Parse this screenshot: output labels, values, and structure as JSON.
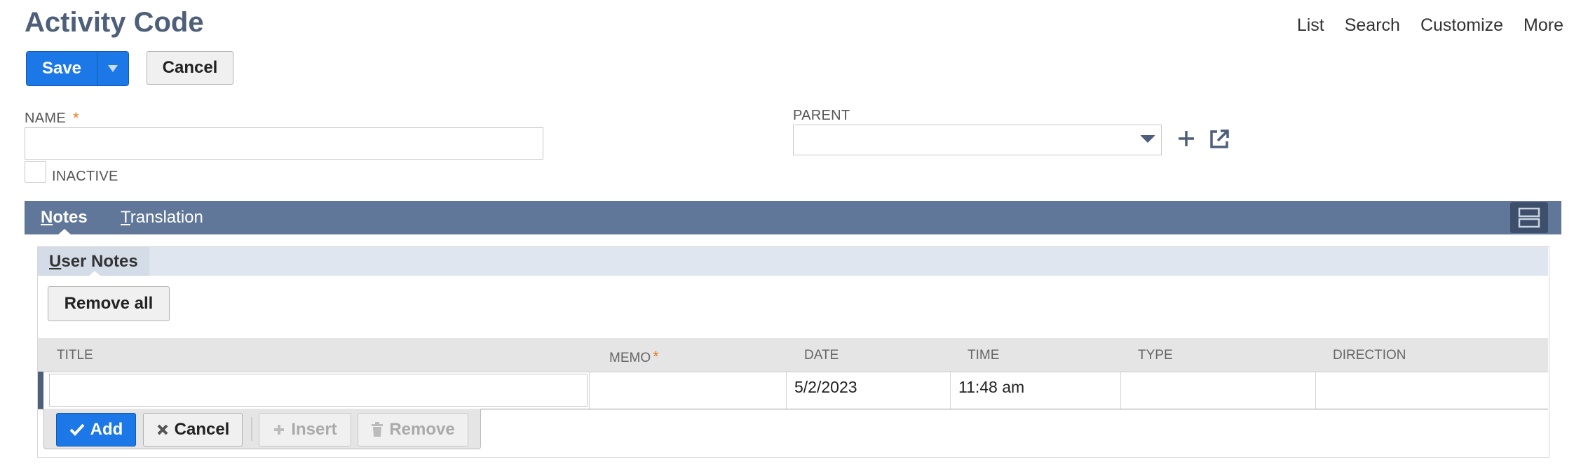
{
  "header": {
    "title": "Activity Code",
    "nav": [
      "List",
      "Search",
      "Customize",
      "More"
    ]
  },
  "toolbar": {
    "save_label": "Save",
    "cancel_label": "Cancel"
  },
  "form": {
    "name_label": "NAME",
    "required_mark": "*",
    "name_value": "",
    "inactive_label": "INACTIVE",
    "parent_label": "PARENT",
    "parent_value": ""
  },
  "tabs": {
    "notes": {
      "first": "N",
      "rest": "otes"
    },
    "translation": {
      "first": "T",
      "rest": "ranslation"
    }
  },
  "subtabs": {
    "user_notes": {
      "first": "U",
      "rest": "ser Notes"
    }
  },
  "notes_list": {
    "remove_all_label": "Remove all",
    "columns": {
      "title": "TITLE",
      "memo": "MEMO",
      "date": "DATE",
      "time": "TIME",
      "type": "TYPE",
      "direction": "DIRECTION"
    },
    "edit_row": {
      "title": "",
      "memo": "",
      "date": "5/2/2023",
      "time": "11:48 am",
      "type": "",
      "direction": ""
    },
    "row_actions": {
      "add": "Add",
      "cancel": "Cancel",
      "insert": "Insert",
      "remove": "Remove"
    }
  },
  "colors": {
    "accent": "#1c78e6",
    "tabbar": "#607799",
    "title": "#4d5f79",
    "required": "#e57c1f"
  }
}
